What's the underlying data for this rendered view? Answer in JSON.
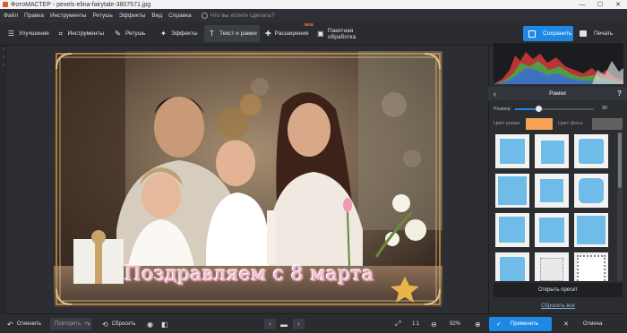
{
  "titlebar": {
    "title": "ФотоМАСТЕР - pexels-elina-fairytale-3807571.jpg",
    "min": "—",
    "max": "☐",
    "close": "✕"
  },
  "menu": {
    "items": [
      "Файл",
      "Правка",
      "Инструменты",
      "Ретушь",
      "Эффекты",
      "Вид",
      "Справка"
    ],
    "search_placeholder": "Что вы хотите сделать?"
  },
  "toolbar": {
    "tabs": [
      {
        "label": "Улучшения",
        "icon": "sliders-icon"
      },
      {
        "label": "Инструменты",
        "icon": "crop-icon"
      },
      {
        "label": "Ретушь",
        "icon": "brush-icon"
      },
      {
        "label": "Эффекты",
        "icon": "magic-wand-icon"
      },
      {
        "label": "Текст и рамки",
        "icon": "text-icon"
      },
      {
        "label": "Расширения",
        "icon": "plus-icon",
        "badge": "NEW"
      },
      {
        "label": "Пакетная обработка",
        "icon": "batch-icon"
      }
    ],
    "active_tab": "Текст и рамки",
    "save_label": "Сохранить",
    "print_label": "Печать"
  },
  "canvas": {
    "caption": "Поздравляем с 8 марта"
  },
  "panel": {
    "title": "Рамки",
    "back": "‹",
    "help": "?",
    "size_label": "Размер",
    "size_value": "30",
    "size_fraction": 0.3,
    "frame_color_label": "Цвет рамки",
    "bg_color_label": "Цвет фона",
    "frame_color": "#f5a355",
    "bg_color": "#616161",
    "open_preset_label": "Открыть пресет",
    "reset_all_label": "Сбросить все"
  },
  "bottombar": {
    "undo_label": "Отменить",
    "redo_label": "Повторить",
    "reset_label": "Сбросить",
    "zoom_1_1": "1:1",
    "zoom_value": "92%",
    "apply_label": "Применить",
    "cancel_label": "Отмена"
  },
  "colors": {
    "accent": "#1e88e5",
    "frame_tile_fill": "#6fbce9"
  }
}
